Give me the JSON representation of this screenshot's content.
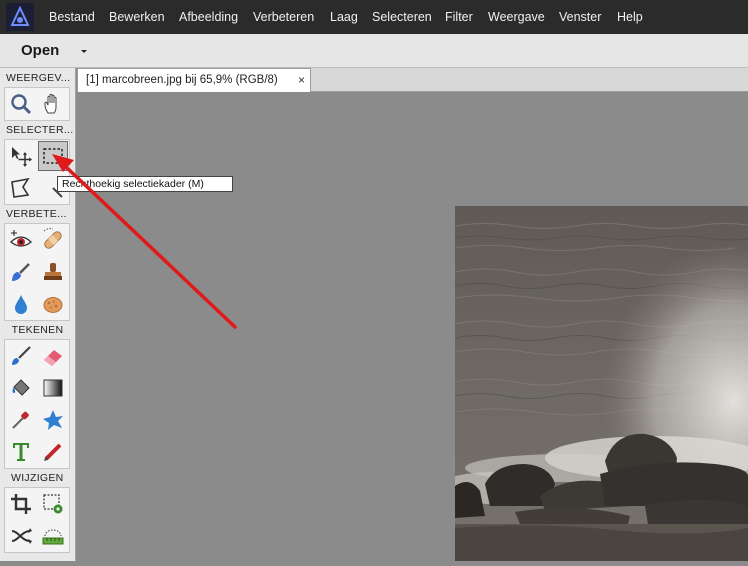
{
  "menubar": {
    "items": [
      "Bestand",
      "Bewerken",
      "Afbeelding",
      "Verbeteren",
      "Laag",
      "Selecteren",
      "Filter",
      "Weergave",
      "Venster",
      "Help"
    ]
  },
  "toolbar": {
    "open_label": "Open"
  },
  "toolbox": {
    "sections": [
      {
        "label": "WEERGEV...",
        "tools": [
          "zoom-icon",
          "hand-icon"
        ]
      },
      {
        "label": "SELECTER...",
        "tools": [
          "move-icon",
          "rectangular-marquee-icon",
          "lasso-icon",
          "quick-selection-icon"
        ]
      },
      {
        "label": "VERBETE...",
        "tools": [
          "red-eye-icon",
          "bandage-icon",
          "smart-brush-icon",
          "clone-stamp-icon",
          "blur-icon",
          "sponge-icon"
        ]
      },
      {
        "label": "TEKENEN",
        "tools": [
          "brush-icon",
          "eraser-icon",
          "paint-bucket-icon",
          "gradient-icon",
          "eyedropper-icon",
          "custom-shape-icon",
          "type-icon",
          "pencil-icon"
        ]
      },
      {
        "label": "WIJZIGEN",
        "tools": [
          "crop-icon",
          "recompose-icon",
          "content-aware-move-icon",
          "straighten-icon"
        ]
      }
    ],
    "active_tool": "rectangular-marquee-icon"
  },
  "tooltip": {
    "text": "Rechthoekig selectiekader (M)"
  },
  "document_tab": {
    "title": "[1] marcobreen.jpg bij 65,9% (RGB/8)",
    "close": "×"
  },
  "colors": {
    "menubar_bg": "#2b2b2b",
    "canvas_bg": "#8b8b8b",
    "arrow": "#e0191b"
  }
}
